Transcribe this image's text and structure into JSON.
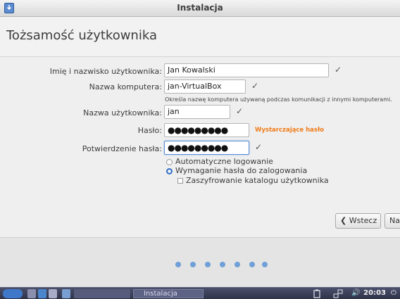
{
  "window": {
    "title": "Instalacja"
  },
  "page": {
    "title": "Tożsamość użytkownika"
  },
  "form": {
    "full_name": {
      "label": "Imię i nazwisko użytkownika:",
      "value": "Jan Kowalski",
      "check": "✓"
    },
    "computer_name": {
      "label": "Nazwa komputera:",
      "value": "jan-VirtualBox",
      "check": "✓",
      "hint": "Określa nazwę komputera używaną podczas komunikacji z innymi komputerami."
    },
    "username": {
      "label": "Nazwa użytkownika:",
      "value": "jan",
      "check": "✓"
    },
    "password": {
      "label": "Hasło:",
      "value": "●●●●●●●●●",
      "strength": "Wystarczające hasło"
    },
    "confirm_password": {
      "label": "Potwierdzenie hasła:",
      "value": "●●●●●●●●●",
      "check": "✓"
    },
    "login_options": {
      "auto_login": {
        "label": "Automatyczne logowanie",
        "selected": false
      },
      "require_password": {
        "label": "Wymaganie hasła do zalogowania",
        "selected": true
      },
      "encrypt_home": {
        "label": "Zaszyfrowanie katalogu użytkownika",
        "checked": false
      }
    }
  },
  "buttons": {
    "back": "❮ Wstecz",
    "next": "Na"
  },
  "progress": {
    "total_steps": 7
  },
  "taskbar": {
    "task_label": "Instalacja",
    "clock": "20:03",
    "volume": "🔊",
    "power": "⏻"
  }
}
